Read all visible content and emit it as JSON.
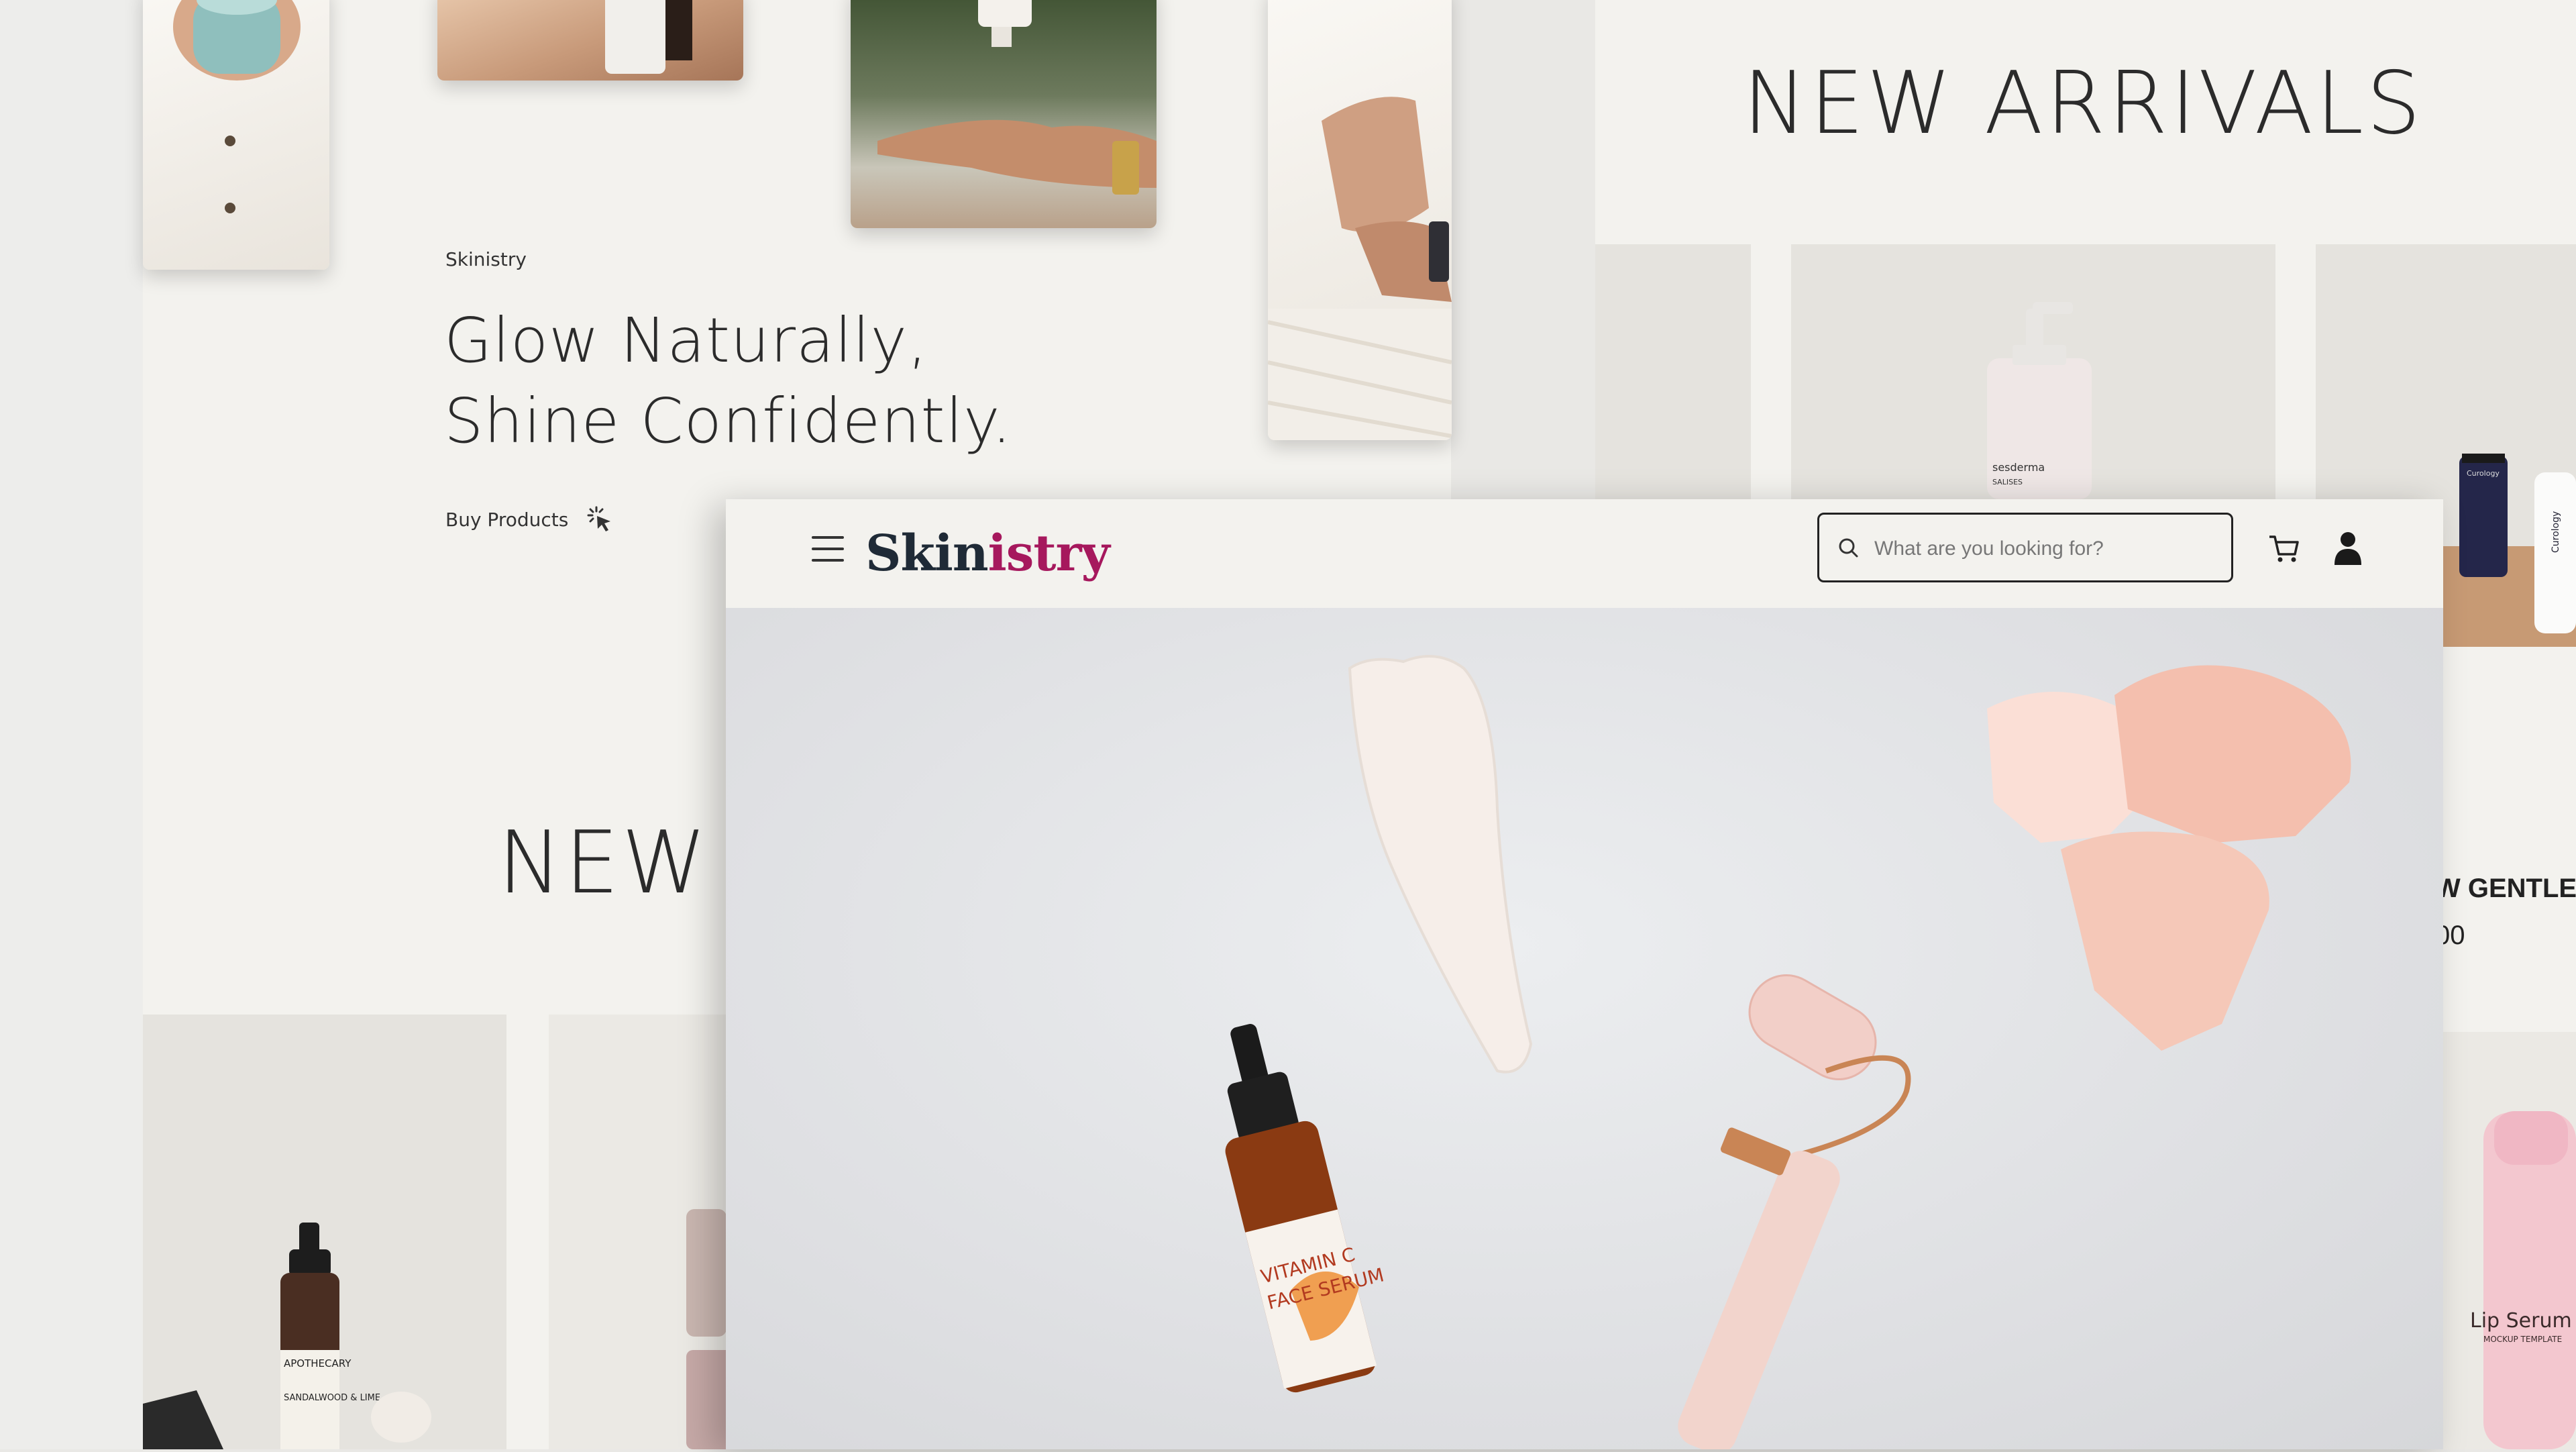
{
  "left_page": {
    "brand": "Skinistry",
    "headline_line1": "Glow Naturally,",
    "headline_line2": "Shine Confidently.",
    "cta_label": "Buy Products",
    "section_title": "NEW A"
  },
  "right_page": {
    "section_title": "NEW ARRIVALS",
    "product_name_partial": "W GENTLE",
    "product_price_partial": "00",
    "tube_brand": "Curology",
    "bottle_brand": "sesderma",
    "bottle_sub": "SALISES",
    "lip_label": "Lip Serum",
    "lip_sub": "MOCKUP TEMPLATE"
  },
  "window": {
    "logo_part1": "Skin",
    "logo_part2": "istry",
    "search": {
      "placeholder": "What are you looking for?"
    },
    "hero_bottle_label1": "VITAMIN C",
    "hero_bottle_label2": "FACE SERUM"
  },
  "left_cards": {
    "bottle_label1": "APOTHECARY",
    "bottle_label2": "SANDALWOOD & LIME"
  },
  "colors": {
    "accent": "#a6185d",
    "logo_dark": "#1f2a36",
    "panel": "#f3f2ee"
  },
  "icons": [
    "menu-icon",
    "search-icon",
    "cart-icon",
    "user-icon",
    "cursor-click-icon"
  ]
}
